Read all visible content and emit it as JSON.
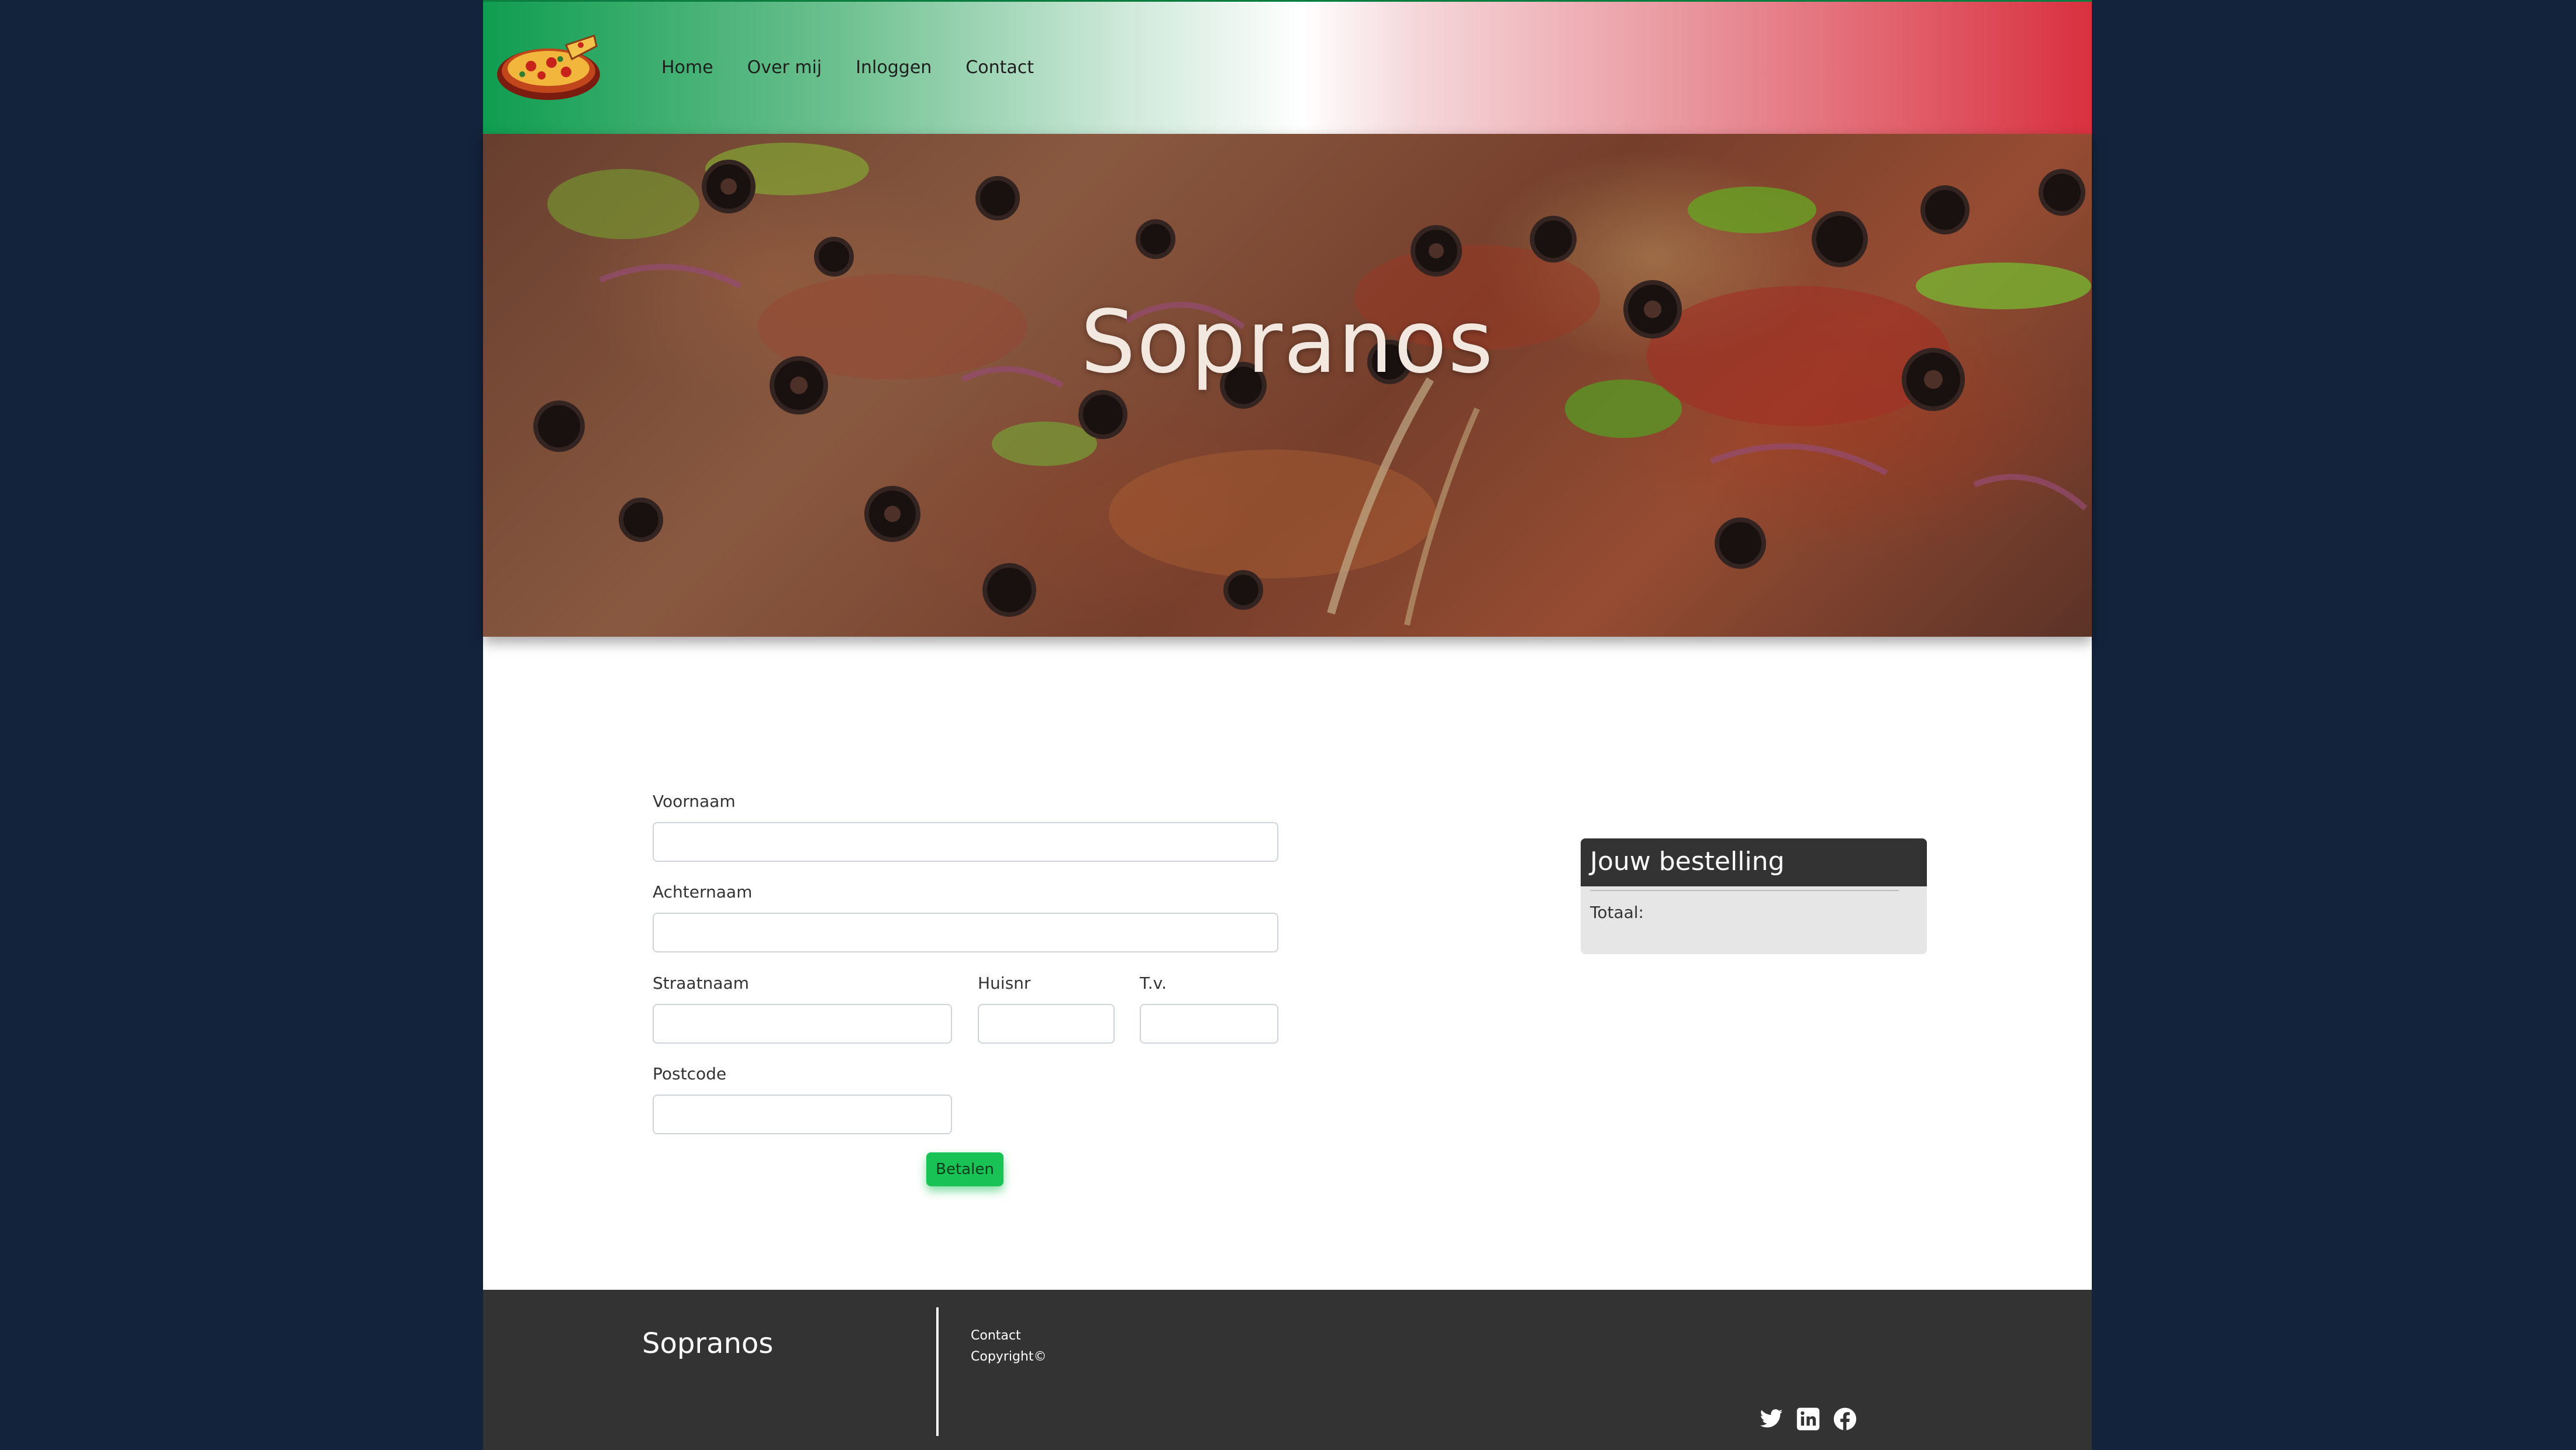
{
  "nav": {
    "logo_icon": "pizza-logo-icon",
    "links": [
      "Home",
      "Over mij",
      "Inloggen",
      "Contact"
    ]
  },
  "hero": {
    "title": "Sopranos"
  },
  "form": {
    "first_name_label": "Voornaam",
    "last_name_label": "Achternaam",
    "street_label": "Straatnaam",
    "house_number_label": "Huisnr",
    "addition_label": "T.v.",
    "postcode_label": "Postcode",
    "pay_button": "Betalen"
  },
  "order": {
    "title": "Jouw bestelling",
    "total_label": "Totaal:"
  },
  "footer": {
    "brand": "Sopranos",
    "links": [
      "Contact",
      "Copyright©"
    ],
    "social_icons": [
      "twitter-icon",
      "linkedin-icon",
      "facebook-icon"
    ]
  },
  "colors": {
    "background": "#13233b",
    "nav_green": "#0f9d50",
    "nav_red": "#d9303f",
    "button_green": "#18c254",
    "footer": "#333333"
  }
}
